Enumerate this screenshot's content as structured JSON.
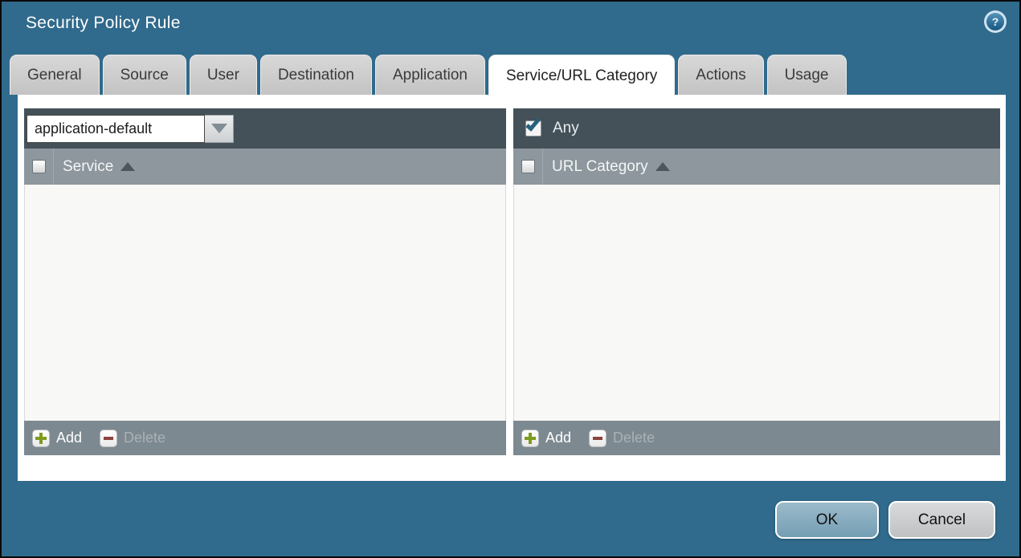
{
  "window": {
    "title": "Security Policy Rule"
  },
  "icons": {
    "help_glyph": "?"
  },
  "tabs": [
    {
      "label": "General",
      "active": false
    },
    {
      "label": "Source",
      "active": false
    },
    {
      "label": "User",
      "active": false
    },
    {
      "label": "Destination",
      "active": false
    },
    {
      "label": "Application",
      "active": false
    },
    {
      "label": "Service/URL Category",
      "active": true
    },
    {
      "label": "Actions",
      "active": false
    },
    {
      "label": "Usage",
      "active": false
    }
  ],
  "active_tab": "Service/URL Category",
  "service_panel": {
    "dropdown_value": "application-default",
    "column_header": "Service",
    "rows": [],
    "add_label": "Add",
    "delete_label": "Delete",
    "delete_enabled": false
  },
  "url_category_panel": {
    "any_label": "Any",
    "any_checked": true,
    "column_header": "URL Category",
    "rows": [],
    "add_label": "Add",
    "delete_label": "Delete",
    "delete_enabled": false
  },
  "dialog_buttons": {
    "ok": "OK",
    "cancel": "Cancel"
  },
  "colors": {
    "background_teal": "#306a8c",
    "panel_topbar": "#445159",
    "panel_header": "#8d979d",
    "panel_footer": "#7d8990",
    "add_icon_green": "#7d9c1f",
    "delete_icon_red": "#8e423c",
    "ok_button": "#82a9bd",
    "cancel_button": "#c7c9cb",
    "checkmark_teal": "#27617c"
  }
}
